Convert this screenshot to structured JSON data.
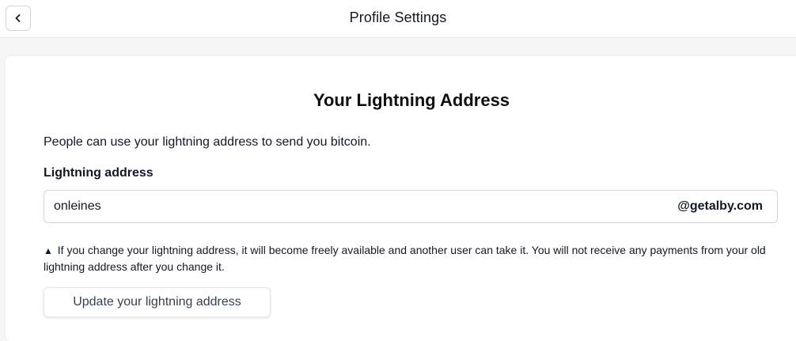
{
  "header": {
    "back_icon": "chevron-left-icon",
    "title": "Profile Settings"
  },
  "card": {
    "title": "Your Lightning Address",
    "description": "People can use your lightning address to send you bitcoin.",
    "field_label": "Lightning address",
    "address_value": "onleines",
    "domain_suffix": "@getalby.com",
    "warning_icon": "warning-triangle-icon",
    "warning_text": "If you change your lightning address, it will become freely available and another user can take it. You will not receive any payments from your old lightning address after you change it.",
    "update_button_label": "Update your lightning address"
  },
  "colors": {
    "background": "#f5f5f6",
    "card": "#ffffff",
    "text": "#111827",
    "border": "#d1d5db"
  }
}
